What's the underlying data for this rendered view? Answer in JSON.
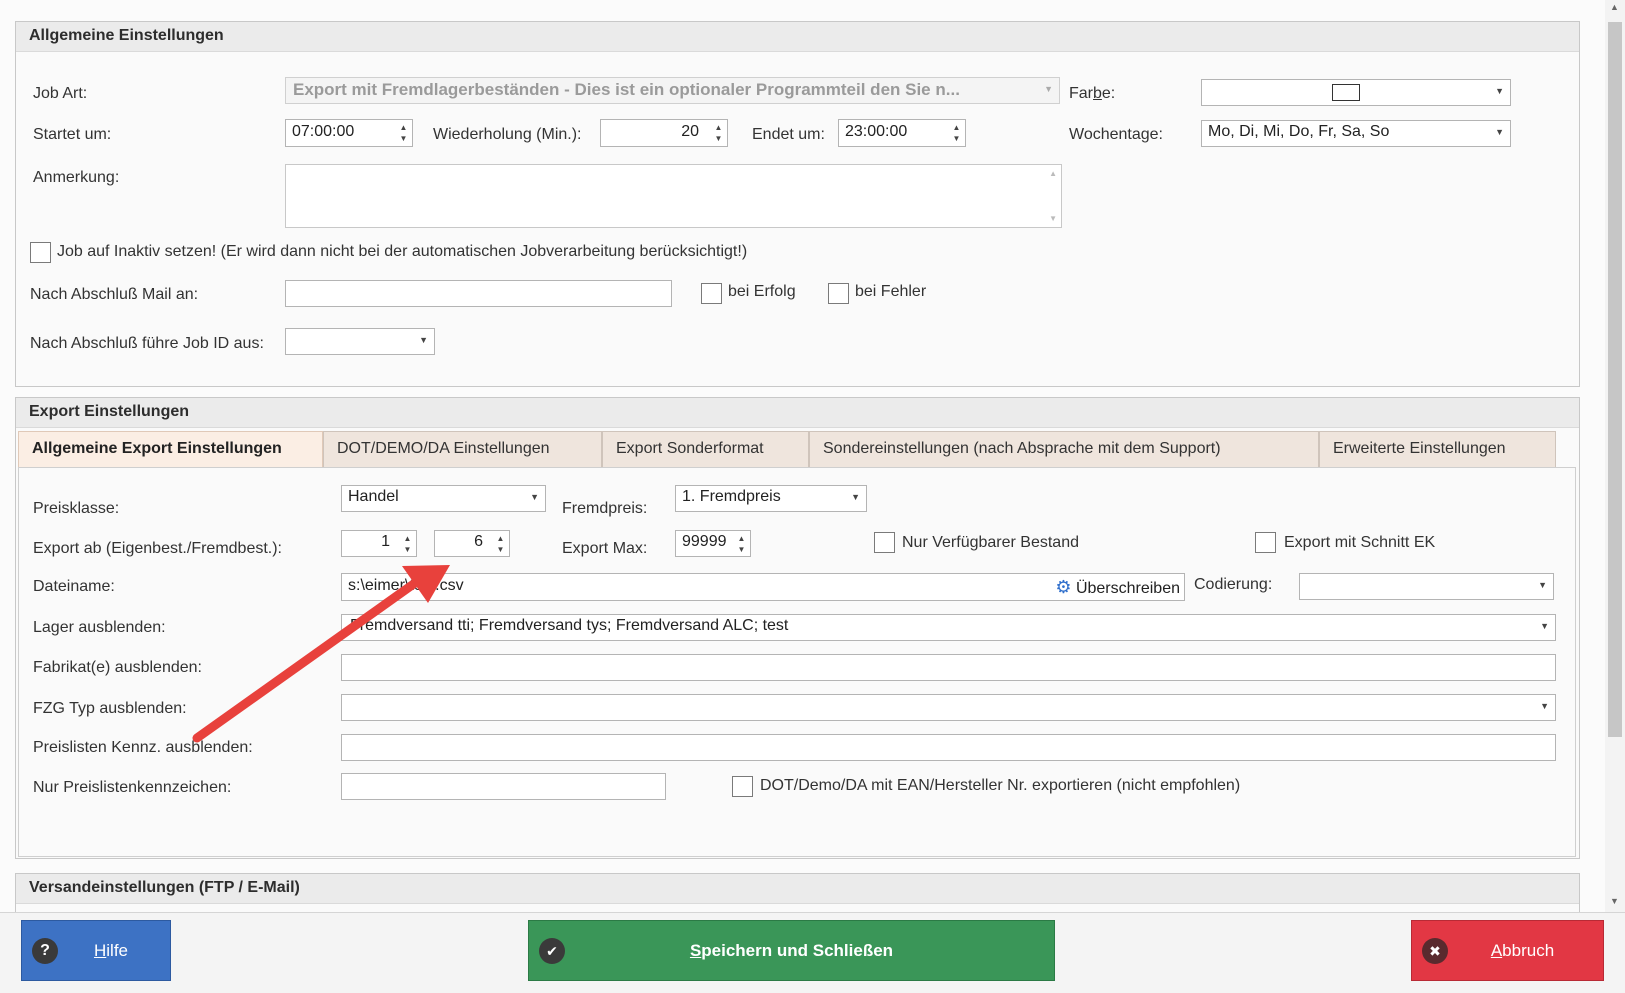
{
  "general": {
    "header": "Allgemeine Einstellungen",
    "job_art_label": "Job Art:",
    "job_art_value": "Export mit Fremdlagerbeständen - Dies ist ein optionaler Programmteil den Sie n...",
    "farbe_label_pre": "Far",
    "farbe_label_mnemonic": "b",
    "farbe_label_post": "e:",
    "startet_label": "Startet um:",
    "startet_value": "07:00:00",
    "wiederholung_label": "Wiederholung (Min.):",
    "wiederholung_value": "20",
    "endet_label": "Endet um:",
    "endet_value": "23:00:00",
    "wochentage_label": "Wochentage:",
    "wochentage_value": "Mo, Di, Mi, Do, Fr, Sa, So",
    "anmerkung_label": "Anmerkung:",
    "inaktiv_label": "Job auf Inaktiv setzen! (Er wird dann nicht bei der automatischen Jobverarbeitung berücksichtigt!)",
    "mail_label": "Nach Abschluß Mail an:",
    "erfolg_label": "bei Erfolg",
    "fehler_label": "bei Fehler",
    "job_id_label": "Nach Abschluß führe Job ID aus:"
  },
  "export": {
    "header": "Export Einstellungen",
    "tabs": [
      {
        "label": "Allgemeine Export Einstellungen"
      },
      {
        "label": "DOT/DEMO/DA Einstellungen"
      },
      {
        "label": "Export Sonderformat"
      },
      {
        "label": "Sondereinstellungen (nach Absprache mit dem Support)"
      },
      {
        "label": "Erweiterte Einstellungen"
      }
    ],
    "preisklasse_label": "Preisklasse:",
    "preisklasse_value": "Handel",
    "fremdpreis_label": "Fremdpreis:",
    "fremdpreis_value": "1. Fremdpreis",
    "export_ab_label": "Export ab (Eigenbest./Fremdbest.):",
    "export_ab_eigen": "1",
    "export_ab_fremd": "6",
    "export_max_label": "Export Max:",
    "export_max_value": "99999",
    "nur_verfuegbar_label": "Nur Verfügbarer Bestand",
    "schnitt_ek_label": "Export mit Schnitt EK",
    "dateiname_label": "Dateiname:",
    "dateiname_value": "s:\\eimer\\test.csv",
    "ueberschreiben_label": "Überschreiben",
    "codierung_label": "Codierung:",
    "lager_label": "Lager ausblenden:",
    "lager_value": "Fremdversand tti; Fremdversand tys; Fremdversand ALC; test",
    "fabrikat_label": "Fabrikat(e) ausblenden:",
    "fzg_label": "FZG Typ  ausblenden:",
    "preislisten_label": "Preislisten Kennz. ausblenden:",
    "nur_preislisten_label": "Nur Preislistenkennzeichen:",
    "dot_ean_label": "DOT/Demo/DA mit EAN/Hersteller Nr. exportieren (nicht empfohlen)"
  },
  "versand": {
    "header": "Versandeinstellungen (FTP / E-Mail)"
  },
  "buttons": {
    "hilfe_mnemonic": "H",
    "hilfe_rest": "ilfe",
    "save_mnemonic": "S",
    "save_rest": "peichern und Schließen",
    "abbruch_mnemonic": "A",
    "abbruch_rest": "bbruch"
  },
  "colors": {
    "hilfe_bg": "#3d72c4",
    "save_bg": "#3a9658",
    "abbruch_bg": "#e23744",
    "arrow": "#e8413c"
  },
  "icons": {
    "hilfe": "?",
    "save": "✔",
    "abbruch": "✖",
    "gear": "⚙"
  }
}
